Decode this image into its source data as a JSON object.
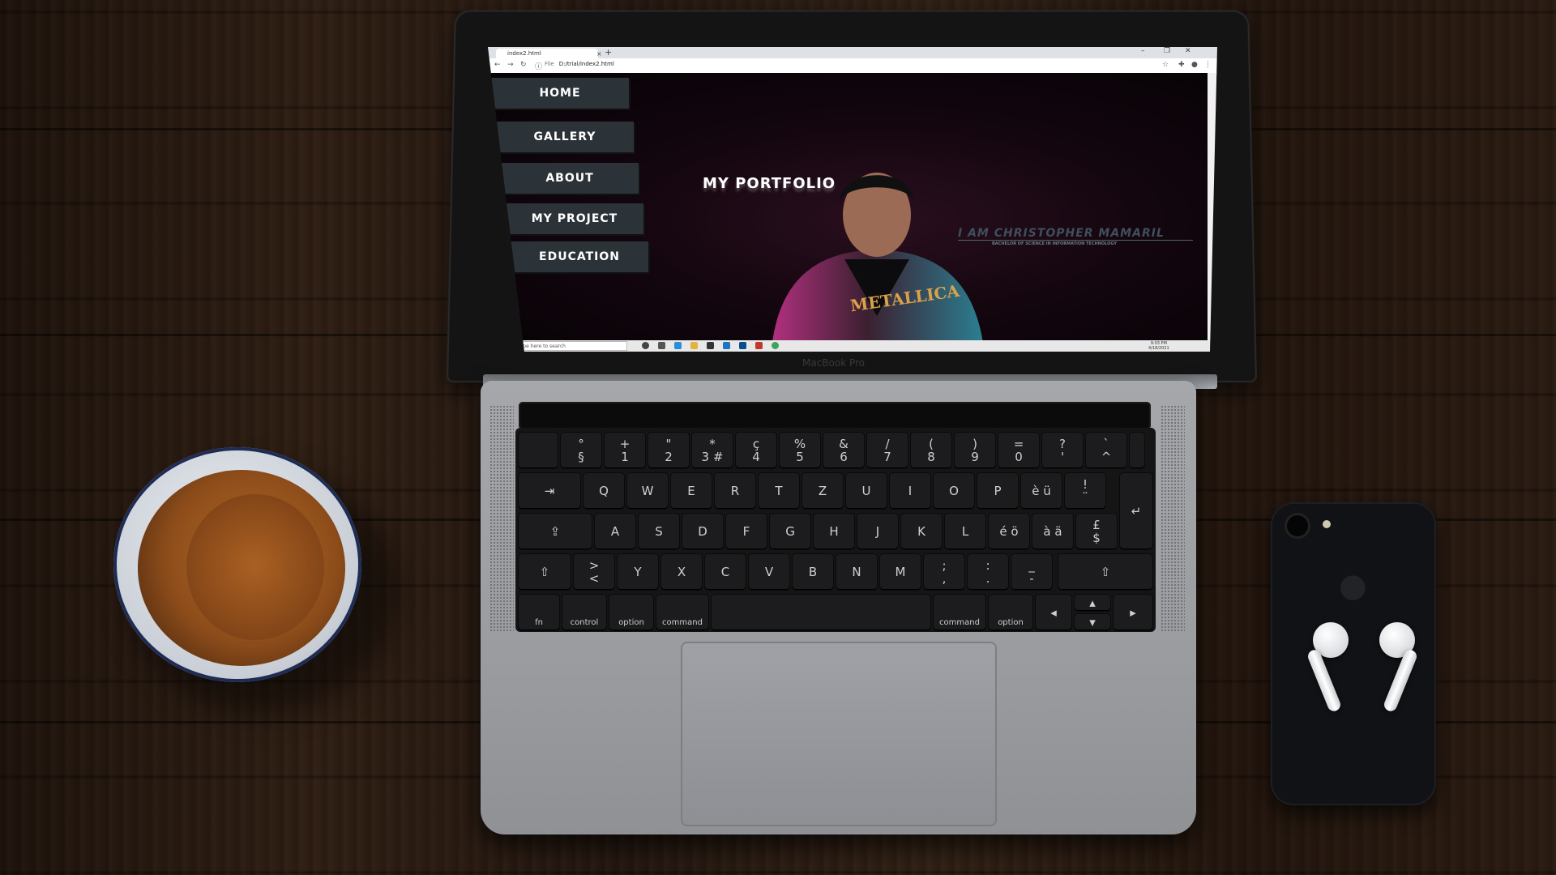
{
  "browser": {
    "tab_title": "index2.html",
    "tab_close": "×",
    "tab_new": "+",
    "url_prefix": "File",
    "url": "D:/trial/index2.html"
  },
  "nav": {
    "items": [
      {
        "label": "HOME"
      },
      {
        "label": "GALLERY"
      },
      {
        "label": "ABOUT"
      },
      {
        "label": "MY PROJECT"
      },
      {
        "label": "EDUCATION"
      }
    ]
  },
  "hero": {
    "title": "MY PORTFOLIO",
    "name": "I AM CHRISTOPHER MAMARIL",
    "subtitle": "BACHELOR OF SCIENCE IN INFORMATION TECHNOLOGY",
    "shirt_text": "METALLICA"
  },
  "taskbar": {
    "search_placeholder": "Type here to search",
    "time": "9:03 PM",
    "date": "4/18/2021"
  },
  "laptop": {
    "model_label": "MacBook Pro",
    "row1": [
      "°\n§",
      "+\n1",
      "\"\n2",
      "*\n3 #",
      "ç\n4",
      "%\n5",
      "&\n6",
      "/\n7",
      "(\n8",
      ")\n9",
      "=\n0",
      "?\n'",
      "`\n^"
    ],
    "row2": [
      "Q",
      "W",
      "E",
      "R",
      "T",
      "Z",
      "U",
      "I",
      "O",
      "P",
      "è ü",
      "!\n¨"
    ],
    "row3": [
      "A",
      "S",
      "D",
      "F",
      "G",
      "H",
      "J",
      "K",
      "L",
      "é ö",
      "à ä",
      "£\n$"
    ],
    "row4": [
      ">\n<",
      "Y",
      "X",
      "C",
      "V",
      "B",
      "N",
      "M",
      ";\n,",
      ":\n.",
      "_\n-"
    ],
    "mod_fn": "fn",
    "mod_control": "control",
    "mod_option": "option",
    "mod_command": "command"
  },
  "colors": {
    "nav_button_bg": "#2c3338",
    "page_bg": "#14060f",
    "hero_name": "#3f4f5c"
  }
}
